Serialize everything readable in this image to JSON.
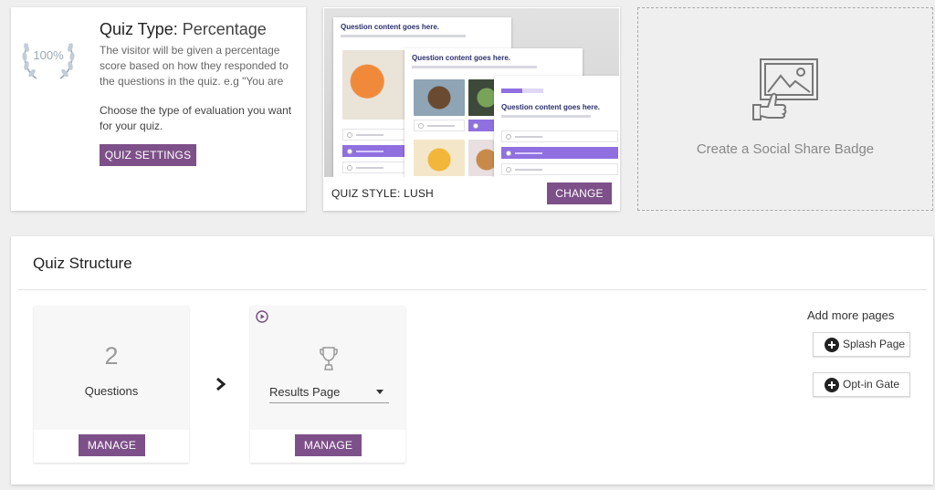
{
  "quiz_type": {
    "title_label": "Quiz Type:",
    "title_value": "Percentage",
    "badge_text": "100%",
    "description": "The visitor will be given a percentage score based on how they responded to the questions in the quiz. e.g \"You are",
    "help_text": "Choose the type of evaluation you want for your quiz.",
    "settings_button": "QUIZ SETTINGS"
  },
  "quiz_style": {
    "label": "QUIZ STYLE: LUSH",
    "change_button": "CHANGE",
    "preview_heading": "Question content goes here."
  },
  "social_badge": {
    "label": "Create a Social Share Badge"
  },
  "structure": {
    "title": "Quiz Structure",
    "questions": {
      "count": "2",
      "label": "Questions",
      "manage_button": "MANAGE"
    },
    "results": {
      "selected": "Results Page",
      "manage_button": "MANAGE"
    },
    "add_more": {
      "label": "Add more pages",
      "splash_button": "Splash Page",
      "optin_button": "Opt-in Gate"
    }
  },
  "colors": {
    "accent": "#7d5089",
    "preview_accent": "#9070e0",
    "background": "#efefef"
  },
  "icons": [
    "laurel-icon",
    "social-badge-icon",
    "play-icon",
    "trophy-icon",
    "chevron-right-icon",
    "plus-circle-icon"
  ]
}
